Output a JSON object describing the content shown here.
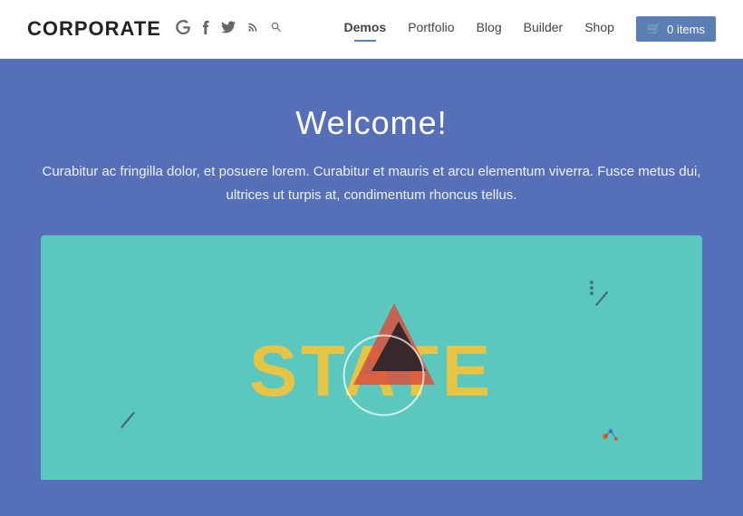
{
  "header": {
    "logo": "CORPORATE",
    "social": [
      {
        "name": "google-plus",
        "symbol": "g+"
      },
      {
        "name": "facebook",
        "symbol": "f"
      },
      {
        "name": "twitter",
        "symbol": "t"
      },
      {
        "name": "rss",
        "symbol": "rss"
      },
      {
        "name": "search",
        "symbol": "🔍"
      }
    ],
    "nav": [
      {
        "label": "Demos",
        "active": true
      },
      {
        "label": "Portfolio",
        "active": false
      },
      {
        "label": "Blog",
        "active": false
      },
      {
        "label": "Builder",
        "active": false
      },
      {
        "label": "Shop",
        "active": false
      }
    ],
    "cart": {
      "label": "0 items",
      "icon": "🛒"
    }
  },
  "hero": {
    "title": "Welcome!",
    "subtitle": "Curabitur ac fringilla dolor, et posuere lorem. Curabitur et mauris et arcu elementum viverra. Fusce metus dui, ultrices ut turpis at, condimentum rhoncus tellus.",
    "bg_color": "#5570b8"
  },
  "card": {
    "bg_color": "#5bc8c0",
    "graphic_text": "STATE"
  },
  "colors": {
    "nav_active_underline": "#5b7fb5",
    "cart_bg": "#5b7fb5",
    "hero_bg": "#5570b8",
    "card_bg": "#5bc8c0",
    "state_yellow": "#e8c444",
    "triangle_red": "#dc503c"
  }
}
